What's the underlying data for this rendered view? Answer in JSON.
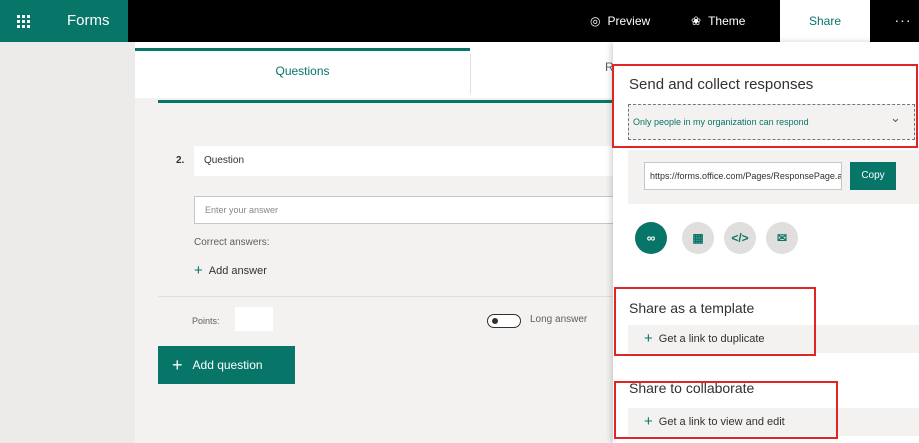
{
  "topbar": {
    "app_name": "Forms",
    "preview_label": "Preview",
    "theme_label": "Theme",
    "share_label": "Share",
    "more_label": "···"
  },
  "tabs": {
    "questions_label": "Questions",
    "responses_stub": "R"
  },
  "question": {
    "number": "2.",
    "title": "Question",
    "answer_placeholder": "Enter your answer",
    "correct_answers_label": "Correct answers:",
    "add_answer_label": "Add answer",
    "points_label": "Points:",
    "long_answer_label": "Long answer"
  },
  "add_question_label": "Add question",
  "share_panel": {
    "send_title": "Send and collect responses",
    "permission_value": "Only people in my organization can respond",
    "link_value": "https://forms.office.com/Pages/ResponsePage.aspx",
    "copy_label": "Copy",
    "share_icons": [
      "link-icon",
      "qr-code-icon",
      "embed-icon",
      "email-icon"
    ],
    "template_title": "Share as a template",
    "template_action": "Get a link to duplicate",
    "collab_title": "Share to collaborate",
    "collab_action": "Get a link to view and edit"
  },
  "colors": {
    "accent": "#077568",
    "highlight": "#e02525"
  }
}
